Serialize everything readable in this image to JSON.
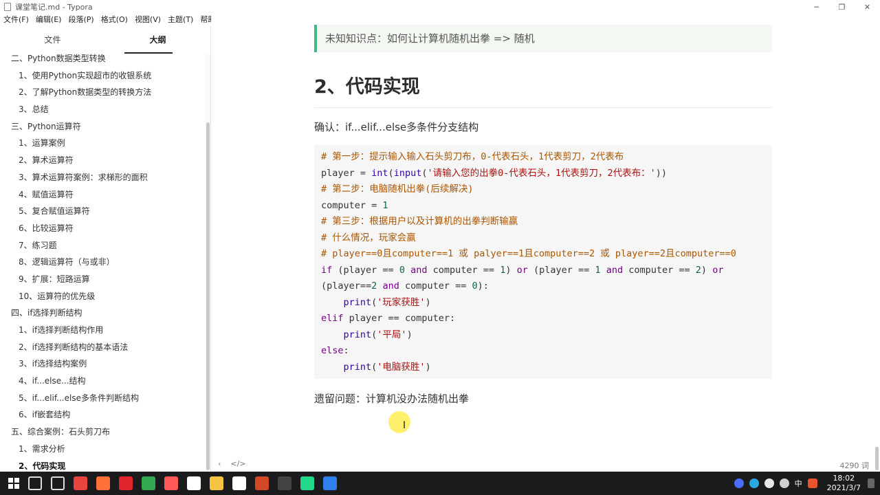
{
  "window": {
    "title": "课堂笔记.md - Typora",
    "controls": [
      "─",
      "❐",
      "✕"
    ]
  },
  "menu": [
    "文件(F)",
    "编辑(E)",
    "段落(P)",
    "格式(O)",
    "视图(V)",
    "主题(T)",
    "帮助(H)"
  ],
  "sidebar": {
    "tabs": [
      "文件",
      "大纲"
    ],
    "active_tab": "大纲",
    "outline": [
      {
        "level": 2,
        "text": "二、Python数据类型转换"
      },
      {
        "level": 3,
        "text": "1、使用Python实现超市的收银系统"
      },
      {
        "level": 3,
        "text": "2、了解Python数据类型的转换方法"
      },
      {
        "level": 3,
        "text": "3、总结"
      },
      {
        "level": 2,
        "text": "三、Python运算符"
      },
      {
        "level": 3,
        "text": "1、运算案例"
      },
      {
        "level": 3,
        "text": "2、算术运算符"
      },
      {
        "level": 3,
        "text": "3、算术运算符案例：求梯形的面积"
      },
      {
        "level": 3,
        "text": "4、赋值运算符"
      },
      {
        "level": 3,
        "text": "5、复合赋值运算符"
      },
      {
        "level": 3,
        "text": "6、比较运算符"
      },
      {
        "level": 3,
        "text": "7、练习题"
      },
      {
        "level": 3,
        "text": "8、逻辑运算符（与或非）"
      },
      {
        "level": 3,
        "text": "9、扩展：短路运算"
      },
      {
        "level": 3,
        "text": "10、运算符的优先级"
      },
      {
        "level": 2,
        "text": "四、if选择判断结构"
      },
      {
        "level": 3,
        "text": "1、if选择判断结构作用"
      },
      {
        "level": 3,
        "text": "2、if选择判断结构的基本语法"
      },
      {
        "level": 3,
        "text": "3、if选择结构案例"
      },
      {
        "level": 3,
        "text": "4、if...else...结构"
      },
      {
        "level": 3,
        "text": "5、if...elif...else多条件判断结构"
      },
      {
        "level": 3,
        "text": "6、if嵌套结构"
      },
      {
        "level": 2,
        "text": "五、综合案例：石头剪刀布"
      },
      {
        "level": 3,
        "text": "1、需求分析"
      },
      {
        "level": 3,
        "text": "2、代码实现",
        "active": true
      }
    ]
  },
  "main": {
    "callout": "未知知识点：如何让计算机随机出拳 => 随机",
    "heading": "2、代码实现",
    "intro": "确认：if...elif...else多条件分支结构",
    "code": [
      [
        {
          "t": "# 第一步：提示输入输入石头剪刀布，0-代表石头，1代表剪刀，2代表布",
          "c": "c-comment"
        }
      ],
      [
        {
          "t": "player ",
          "c": "c-op"
        },
        {
          "t": "= ",
          "c": "c-op"
        },
        {
          "t": "int",
          "c": "c-builtin"
        },
        {
          "t": "(",
          "c": "c-op"
        },
        {
          "t": "input",
          "c": "c-builtin"
        },
        {
          "t": "(",
          "c": "c-op"
        },
        {
          "t": "'请输入您的出拳0-代表石头，1代表剪刀，2代表布：'",
          "c": "c-str"
        },
        {
          "t": "))",
          "c": "c-op"
        }
      ],
      [
        {
          "t": "# 第二步：电脑随机出拳(后续解决)",
          "c": "c-comment"
        }
      ],
      [
        {
          "t": "computer ",
          "c": "c-op"
        },
        {
          "t": "= ",
          "c": "c-op"
        },
        {
          "t": "1",
          "c": "c-num"
        }
      ],
      [
        {
          "t": "# 第三步：根据用户以及计算机的出拳判断输赢",
          "c": "c-comment"
        }
      ],
      [
        {
          "t": "# 什么情况，玩家会赢",
          "c": "c-comment"
        }
      ],
      [
        {
          "t": "# player==0且computer==1 或 palyer==1且computer==2 或 player==2且computer==0",
          "c": "c-comment"
        }
      ],
      [
        {
          "t": "if",
          "c": "c-kw"
        },
        {
          "t": " (player ",
          "c": "c-op"
        },
        {
          "t": "==",
          "c": "c-op"
        },
        {
          "t": " ",
          "c": "c-op"
        },
        {
          "t": "0",
          "c": "c-num"
        },
        {
          "t": " ",
          "c": "c-op"
        },
        {
          "t": "and",
          "c": "c-kw"
        },
        {
          "t": " computer ",
          "c": "c-op"
        },
        {
          "t": "==",
          "c": "c-op"
        },
        {
          "t": " ",
          "c": "c-op"
        },
        {
          "t": "1",
          "c": "c-num"
        },
        {
          "t": ") ",
          "c": "c-op"
        },
        {
          "t": "or",
          "c": "c-kw"
        },
        {
          "t": " (player ",
          "c": "c-op"
        },
        {
          "t": "==",
          "c": "c-op"
        },
        {
          "t": " ",
          "c": "c-op"
        },
        {
          "t": "1",
          "c": "c-num"
        },
        {
          "t": " ",
          "c": "c-op"
        },
        {
          "t": "and",
          "c": "c-kw"
        },
        {
          "t": " computer ",
          "c": "c-op"
        },
        {
          "t": "==",
          "c": "c-op"
        },
        {
          "t": " ",
          "c": "c-op"
        },
        {
          "t": "2",
          "c": "c-num"
        },
        {
          "t": ") ",
          "c": "c-op"
        },
        {
          "t": "or",
          "c": "c-kw"
        }
      ],
      [
        {
          "t": "(player",
          "c": "c-op"
        },
        {
          "t": "==",
          "c": "c-op"
        },
        {
          "t": "2",
          "c": "c-num"
        },
        {
          "t": " ",
          "c": "c-op"
        },
        {
          "t": "and",
          "c": "c-kw"
        },
        {
          "t": " computer ",
          "c": "c-op"
        },
        {
          "t": "==",
          "c": "c-op"
        },
        {
          "t": " ",
          "c": "c-op"
        },
        {
          "t": "0",
          "c": "c-num"
        },
        {
          "t": "):",
          "c": "c-op"
        }
      ],
      [
        {
          "t": "    ",
          "c": "c-op"
        },
        {
          "t": "print",
          "c": "c-builtin"
        },
        {
          "t": "(",
          "c": "c-op"
        },
        {
          "t": "'玩家获胜'",
          "c": "c-str"
        },
        {
          "t": ")",
          "c": "c-op"
        }
      ],
      [
        {
          "t": "elif",
          "c": "c-kw"
        },
        {
          "t": " player ",
          "c": "c-op"
        },
        {
          "t": "==",
          "c": "c-op"
        },
        {
          "t": " computer:",
          "c": "c-op"
        }
      ],
      [
        {
          "t": "    ",
          "c": "c-op"
        },
        {
          "t": "print",
          "c": "c-builtin"
        },
        {
          "t": "(",
          "c": "c-op"
        },
        {
          "t": "'平局'",
          "c": "c-str"
        },
        {
          "t": ")",
          "c": "c-op"
        }
      ],
      [
        {
          "t": "else",
          "c": "c-kw"
        },
        {
          "t": ":",
          "c": "c-op"
        }
      ],
      [
        {
          "t": "    ",
          "c": "c-op"
        },
        {
          "t": "print",
          "c": "c-builtin"
        },
        {
          "t": "(",
          "c": "c-op"
        },
        {
          "t": "'电脑获胜'",
          "c": "c-str"
        },
        {
          "t": ")",
          "c": "c-op"
        }
      ]
    ],
    "remaining_issue": "遗留问题：计算机没办法随机出拳"
  },
  "status": {
    "left_icons": [
      "‹",
      "</>"
    ],
    "word_count": "4290 词"
  },
  "taskbar": {
    "apps": [
      {
        "name": "search-icon",
        "color": "#1b1b1d"
      },
      {
        "name": "task-view-icon",
        "color": "#1b1b1d"
      },
      {
        "name": "chrome-icon",
        "color": "#e8453c"
      },
      {
        "name": "firefox-icon",
        "color": "#ff7139"
      },
      {
        "name": "youdao-icon",
        "color": "#e0262b"
      },
      {
        "name": "chrome-alt-icon",
        "color": "#34a853"
      },
      {
        "name": "screen-record-icon",
        "color": "#ff5a5a"
      },
      {
        "name": "browser-icon",
        "color": "#ffffff"
      },
      {
        "name": "file-explorer-icon",
        "color": "#f5c542"
      },
      {
        "name": "typora-icon",
        "color": "#ffffff"
      },
      {
        "name": "powerpoint-icon",
        "color": "#d24726"
      },
      {
        "name": "recorder-icon",
        "color": "#444444"
      },
      {
        "name": "pycharm-icon",
        "color": "#21d789"
      },
      {
        "name": "vscode-icon",
        "color": "#2f80ed"
      }
    ],
    "time": "18:02",
    "date": "2021/3/7",
    "ime": "中"
  }
}
